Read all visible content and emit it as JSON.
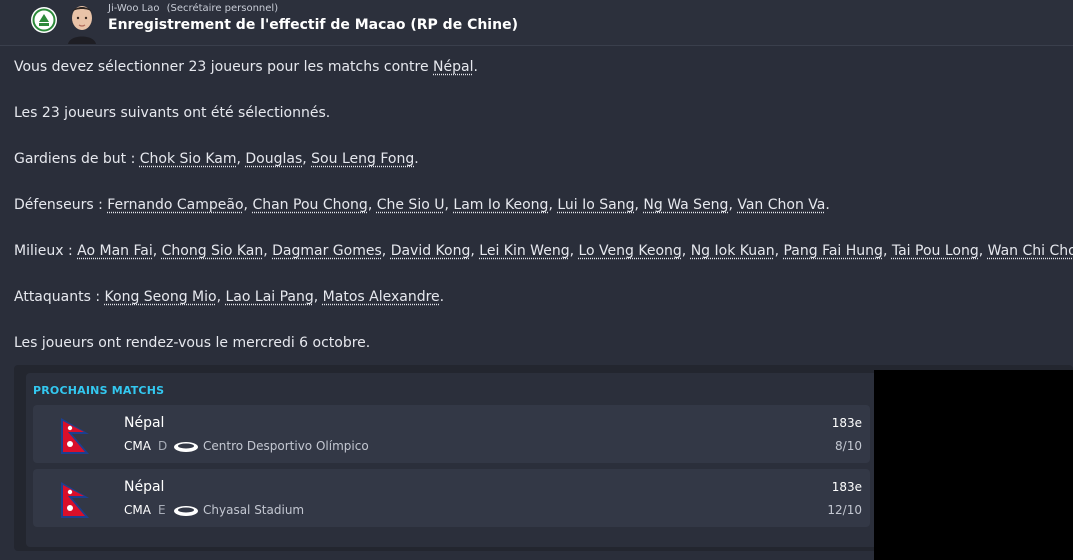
{
  "header": {
    "sender_name": "Ji-Woo Lao",
    "sender_role": "(Secrétaire personnel)",
    "subject": "Enregistrement de l'effectif de Macao (RP de Chine)"
  },
  "body": {
    "p1_prefix": "Vous devez sélectionner 23 joueurs pour les matchs contre ",
    "p1_opponent": "Népal",
    "p1_suffix": ".",
    "p2": "Les 23 joueurs suivants ont été sélectionnés.",
    "goalkeepers_label": "Gardiens de but : ",
    "goalkeepers": [
      "Chok Sio Kam",
      "Douglas",
      "Sou Leng Fong"
    ],
    "defenders_label": "Défenseurs : ",
    "defenders": [
      "Fernando Campeão",
      "Chan Pou Chong",
      "Che Sio U",
      "Lam Io Keong",
      "Lui Io Sang",
      "Ng Wa Seng",
      "Van Chon Va"
    ],
    "midfielders_label": "Milieux : ",
    "midfielders": [
      "Ao Man Fai",
      "Chong Sio Kan",
      "Dagmar Gomes",
      "David Kong",
      "Lei Kin Weng",
      "Lo Veng Keong",
      "Ng Iok Kuan",
      "Pang Fai Hung",
      "Tai Pou Long",
      "Wan Chi Chong"
    ],
    "attackers_label": "Attaquants : ",
    "attackers": [
      "Kong Seong Mio",
      "Lao Lai Pang",
      "Matos Alexandre"
    ],
    "meeting": "Les joueurs ont rendez-vous le mercredi 6 octobre."
  },
  "upcoming": {
    "title": "PROCHAINS MATCHS",
    "matches": [
      {
        "team": "Népal",
        "competition": "CMA",
        "round": "D",
        "stadium": "Centro Desportivo Olímpico",
        "rank": "183e",
        "date": "8/10"
      },
      {
        "team": "Népal",
        "competition": "CMA",
        "round": "E",
        "stadium": "Chyasal Stadium",
        "rank": "183e",
        "date": "12/10"
      }
    ]
  },
  "colors": {
    "accent": "#33c8f0",
    "background": "#2a2e3a",
    "flag_red": "#d90f2a",
    "flag_blue": "#1c3f8f"
  },
  "icons": [
    "club-crest-icon",
    "nepal-flag-icon",
    "stadium-icon"
  ]
}
